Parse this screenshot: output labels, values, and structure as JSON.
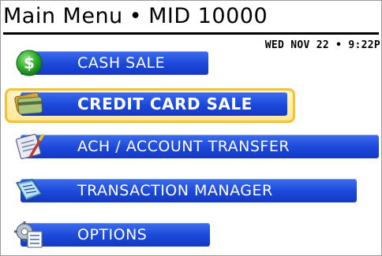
{
  "header": {
    "title": "Main Menu",
    "separator": "•",
    "merchant_id": "MID 10000"
  },
  "status": {
    "datetime": "WED NOV 22 • 9:22P"
  },
  "menu": {
    "items": [
      {
        "label": "CASH SALE",
        "icon": "cash-icon",
        "selected": false
      },
      {
        "label": "CREDIT CARD SALE",
        "icon": "credit-card-icon",
        "selected": true
      },
      {
        "label": "ACH / ACCOUNT TRANSFER",
        "icon": "ach-transfer-icon",
        "selected": false
      },
      {
        "label": "TRANSACTION MANAGER",
        "icon": "transaction-manager-icon",
        "selected": false
      },
      {
        "label": "OPTIONS",
        "icon": "options-icon",
        "selected": false
      }
    ]
  },
  "colors": {
    "bar_blue": "#1b48d8",
    "selection_gold": "#f2c230",
    "cash_green": "#27a02a"
  }
}
